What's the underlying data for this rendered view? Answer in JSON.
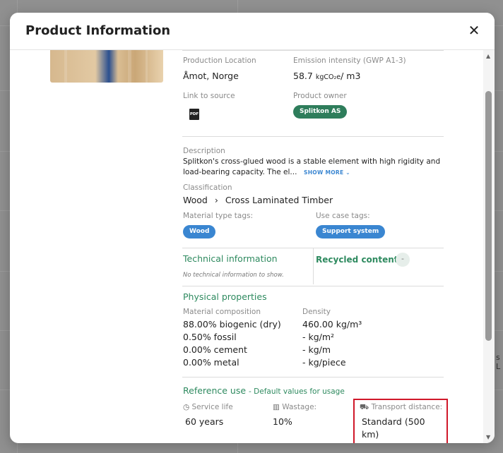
{
  "modal": {
    "title": "Product Information",
    "close_symbol": "✕"
  },
  "overview": {
    "production_location_label": "Production Location",
    "production_location_value": "Åmot, Norge",
    "emission_label": "Emission intensity (GWP A1-3)",
    "emission_value_prefix": "58.7",
    "emission_unit": "kgCO₂e",
    "emission_suffix": "/ m3",
    "link_label": "Link to source",
    "pdf_text": "PDF",
    "owner_label": "Product owner",
    "owner_value": "Splitkon AS"
  },
  "description": {
    "label": "Description",
    "line1": "Splitkon's cross-glued wood is a stable element with high rigidity and",
    "line2": "load-bearing capacity. The el...",
    "show_more": "SHOW MORE ⌄"
  },
  "classification": {
    "label": "Classification",
    "level1": "Wood",
    "separator": "›",
    "level2": "Cross Laminated Timber"
  },
  "tags": {
    "material_label": "Material type tags:",
    "material_tag": "Wood",
    "usecase_label": "Use case tags:",
    "usecase_tag": "Support system"
  },
  "technical": {
    "title": "Technical information",
    "empty_text": "No technical information to show.",
    "recycled_title": "Recycled content:",
    "recycled_value": "-"
  },
  "physical": {
    "title": "Physical properties",
    "composition_label": "Material composition",
    "composition": [
      "88.00% biogenic (dry)",
      "0.50% fossil",
      "0.00% cement",
      "0.00% metal"
    ],
    "density_label": "Density",
    "density": [
      "460.00 kg/m³",
      "- kg/m²",
      "- kg/m",
      "- kg/piece"
    ]
  },
  "reference": {
    "title": "Reference use",
    "subtitle": "- Default values for usage",
    "service_life_label": "Service life",
    "service_life_value": "60 years",
    "wastage_label": "Wastage:",
    "wastage_value": "10%",
    "transport_label": "Transport distance:",
    "transport_value_line1": "Standard (500",
    "transport_value_line2": "km)"
  },
  "scrollbar": {
    "up": "▲",
    "down": "▼"
  },
  "background": {
    "partial_text": "s L"
  },
  "colors": {
    "accent_green": "#2e8a5f",
    "tag_blue": "#3a86d1",
    "owner_chip": "#2e7d5b",
    "highlight_red": "#d0182a"
  }
}
